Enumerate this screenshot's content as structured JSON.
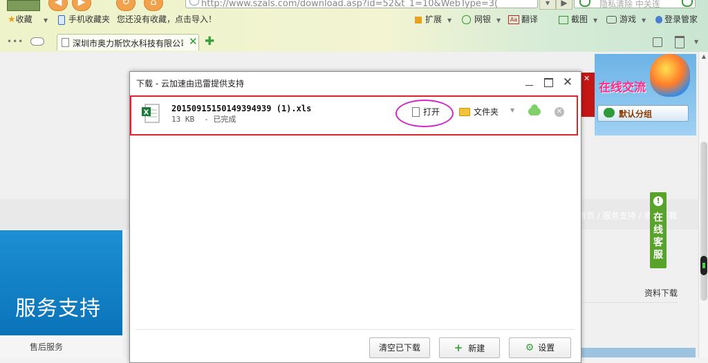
{
  "browser": {
    "address_url": "http://www.szals.com/download.asp?id=52&t_1=10&WebType=3(",
    "search_placeholder": "隐私清除 中关连",
    "favorites_bar": {
      "favorites": "收藏",
      "mobile_favorites": "手机收藏夹",
      "import_hint": "您还没有收藏，点击导入！",
      "extensions": "扩展",
      "netbank": "网银",
      "translate": "翻译",
      "screenshot": "截图",
      "games": "游戏",
      "login": "登录管家"
    },
    "tab": {
      "title": "深圳市奥力斯饮水科技有限公司"
    }
  },
  "page": {
    "service_support": "服务支持",
    "after_sales": "售后服务",
    "breadcrumb": "首页 / 服务支持 / 资料下载",
    "downloads_label": "资料下载",
    "online_chat": "在线交流",
    "default_group": "默认分组",
    "online_service": "在线客服"
  },
  "dialog": {
    "title": "下载 - 云加速由迅雷提供支持",
    "item": {
      "filename": "20150915150149394939 (1).xls",
      "size": "13 KB",
      "status": "- 已完成",
      "open_label": "打开",
      "folder_label": "文件夹"
    },
    "buttons": {
      "clear_done": "清空已下载",
      "new": "新建",
      "settings": "设置"
    }
  }
}
